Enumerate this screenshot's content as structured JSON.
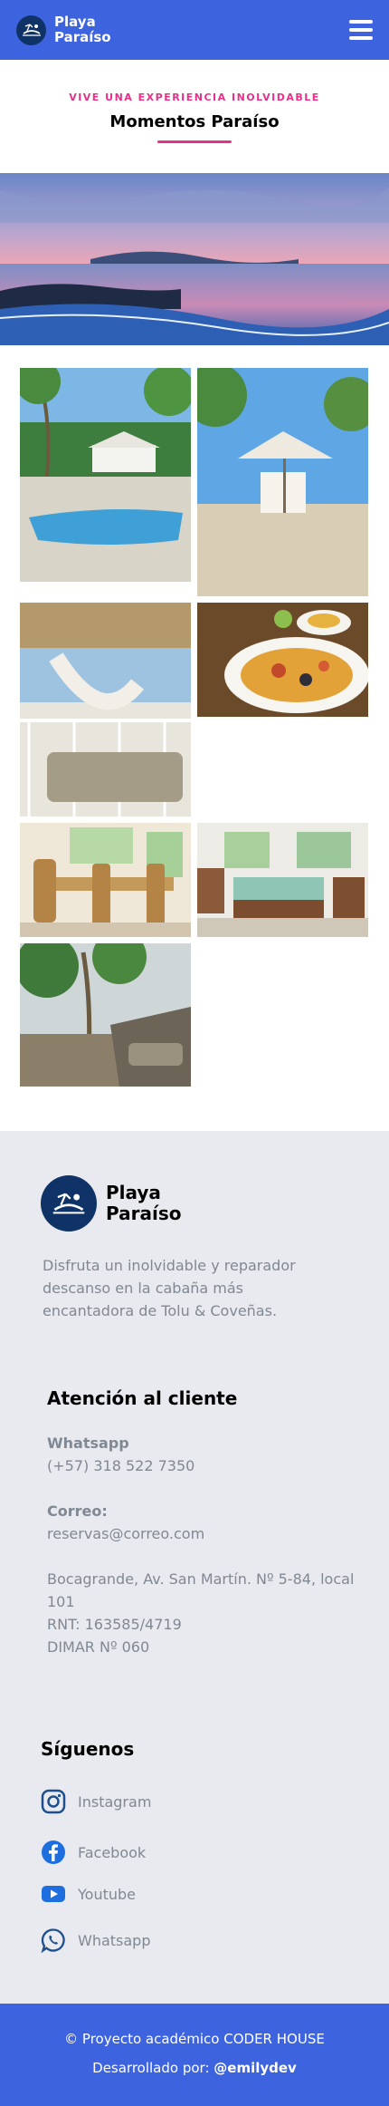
{
  "header": {
    "brand_line1": "Playa",
    "brand_line2": "Paraíso",
    "menu_icon": "hamburger-menu-icon"
  },
  "intro": {
    "eyebrow": "VIVE UNA EXPERIENCIA INOLVIDABLE",
    "title": "Momentos Paraíso"
  },
  "hero": {
    "image": "sunset-beach-photo"
  },
  "gallery": [
    {
      "name": "pool-photo"
    },
    {
      "name": "beach-kiosk-photo"
    },
    {
      "name": "hammock-porch-photo"
    },
    {
      "name": "seafood-paella-photo"
    },
    {
      "name": "dining-room-photo"
    },
    {
      "name": "lounge-room-photo"
    },
    {
      "name": "beach-terrace-photo"
    }
  ],
  "footer": {
    "brand_line1": "Playa",
    "brand_line2": "Paraíso",
    "description": "Disfruta un inolvidable y reparador descanso en la cabaña más encantadora de Tolu & Coveñas.",
    "support_title": "Atención al cliente",
    "whatsapp_label": "Whatsapp",
    "whatsapp_value": "(+57) 318 522 7350",
    "email_label": "Correo:",
    "email_value": "reservas@correo.com",
    "address": "Bocagrande, Av. San Martín. Nº 5-84, local 101",
    "rnt": "RNT: 163585/4719",
    "dimar": "DIMAR Nº 060",
    "follow_title": "Síguenos",
    "socials": [
      {
        "label": "Instagram",
        "icon": "instagram-icon"
      },
      {
        "label": "Facebook",
        "icon": "facebook-icon"
      },
      {
        "label": "Youtube",
        "icon": "youtube-icon"
      },
      {
        "label": "Whatsapp",
        "icon": "whatsapp-icon"
      }
    ]
  },
  "bottom": {
    "line1": "© Proyecto académico CODER HOUSE",
    "line2_prefix": "Desarrollado por:",
    "line2_author": "@emilydev"
  },
  "colors": {
    "primary": "#3d63de",
    "accent": "#e8308a",
    "navy": "#0f3366",
    "footer_bg": "#e9eaef",
    "muted_text": "#808893"
  }
}
